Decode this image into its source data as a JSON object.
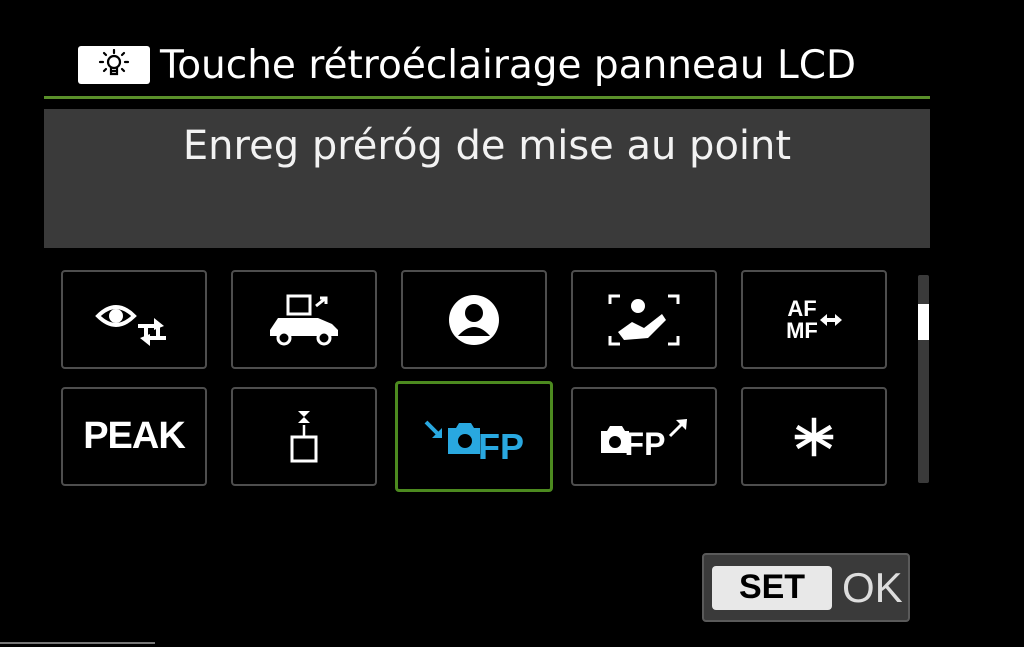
{
  "header": {
    "title": "Touche rétroéclairage panneau LCD",
    "icon": "lightbulb-icon"
  },
  "description": "Enreg préróg de mise au point",
  "grid": {
    "selected_index": 7,
    "accent_color": "#4c8a1f",
    "highlight_color": "#29a8e0",
    "tiles": [
      {
        "icon": "eye-detection-switch-icon"
      },
      {
        "icon": "subject-tracking-vehicle-icon"
      },
      {
        "icon": "person-icon"
      },
      {
        "icon": "eye-detection-frame-icon"
      },
      {
        "icon": "af-mf-switch-icon",
        "line1": "AF",
        "line2": "MF"
      },
      {
        "icon": "peaking-icon",
        "label": "PEAK"
      },
      {
        "icon": "focus-point-icon"
      },
      {
        "icon": "register-focus-preset-icon",
        "label": "FP"
      },
      {
        "icon": "recall-focus-preset-icon",
        "label": "FP"
      },
      {
        "icon": "ae-lock-icon"
      }
    ]
  },
  "scroll": {
    "position": 0.14
  },
  "ok_button": {
    "set": "SET",
    "ok": "OK"
  }
}
